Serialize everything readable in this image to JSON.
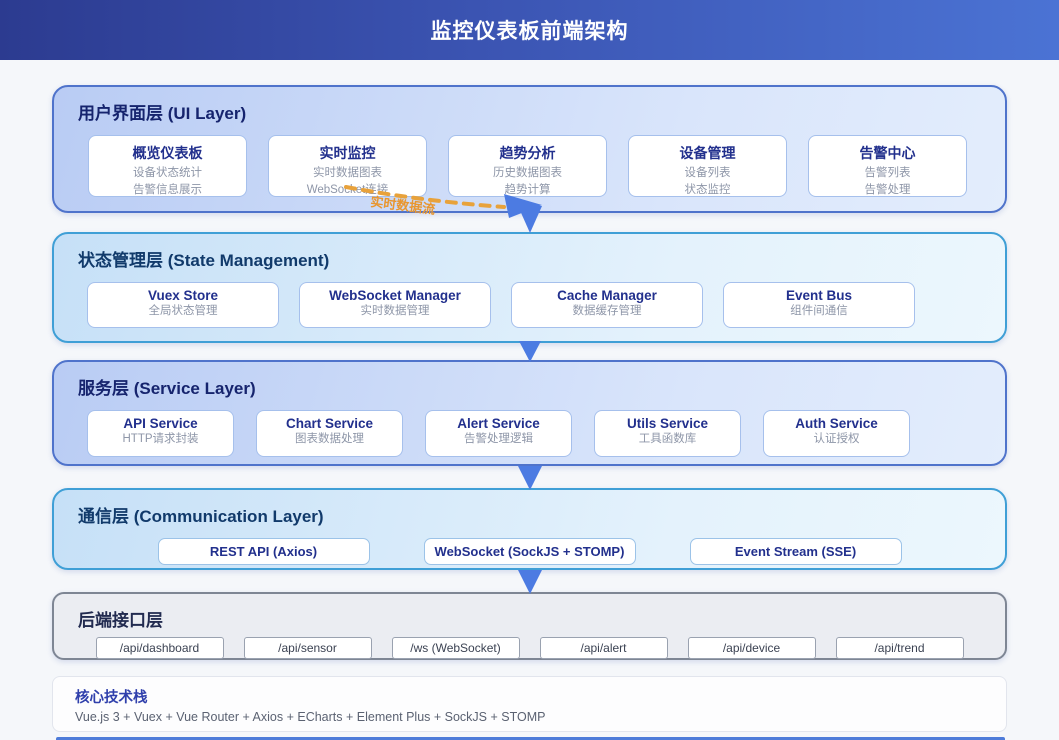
{
  "header": {
    "title": "监控仪表板前端架构"
  },
  "flow": {
    "label": "实时数据流"
  },
  "colors": {
    "arrow": "#4c7be2",
    "flow_line": "#e8a23b",
    "flow_label": "#e8962f"
  },
  "layers": [
    {
      "slug": "ui",
      "title": "用户界面层 (UI Layer)",
      "variant": "blue",
      "cards": [
        {
          "title": "概览仪表板",
          "lines": [
            "设备状态统计",
            "告警信息展示"
          ]
        },
        {
          "title": "实时监控",
          "lines": [
            "实时数据图表",
            "WebSocket连接"
          ]
        },
        {
          "title": "趋势分析",
          "lines": [
            "历史数据图表",
            "趋势计算"
          ]
        },
        {
          "title": "设备管理",
          "lines": [
            "设备列表",
            "状态监控"
          ]
        },
        {
          "title": "告警中心",
          "lines": [
            "告警列表",
            "告警处理"
          ]
        }
      ]
    },
    {
      "slug": "state-management",
      "title": "状态管理层 (State Management)",
      "variant": "cyan",
      "cards": [
        {
          "title": "Vuex Store",
          "lines": [
            "全局状态管理"
          ]
        },
        {
          "title": "WebSocket Manager",
          "lines": [
            "实时数据管理"
          ]
        },
        {
          "title": "Cache Manager",
          "lines": [
            "数据缓存管理"
          ]
        },
        {
          "title": "Event Bus",
          "lines": [
            "组件间通信"
          ]
        }
      ]
    },
    {
      "slug": "service",
      "title": "服务层 (Service Layer)",
      "variant": "blue",
      "cards": [
        {
          "title": "API Service",
          "lines": [
            "HTTP请求封装"
          ]
        },
        {
          "title": "Chart Service",
          "lines": [
            "图表数据处理"
          ]
        },
        {
          "title": "Alert Service",
          "lines": [
            "告警处理逻辑"
          ]
        },
        {
          "title": "Utils Service",
          "lines": [
            "工具函数库"
          ]
        },
        {
          "title": "Auth Service",
          "lines": [
            "认证授权"
          ]
        }
      ]
    },
    {
      "slug": "communication",
      "title": "通信层 (Communication Layer)",
      "variant": "cyan",
      "cards": [
        {
          "title": "REST API (Axios)",
          "lines": []
        },
        {
          "title": "WebSocket (SockJS + STOMP)",
          "lines": []
        },
        {
          "title": "Event Stream (SSE)",
          "lines": []
        }
      ]
    },
    {
      "slug": "backend-api",
      "title": "后端接口层",
      "variant": "gray",
      "cards": [
        {
          "title": "/api/dashboard",
          "lines": []
        },
        {
          "title": "/api/sensor",
          "lines": []
        },
        {
          "title": "/ws (WebSocket)",
          "lines": []
        },
        {
          "title": "/api/alert",
          "lines": []
        },
        {
          "title": "/api/device",
          "lines": []
        },
        {
          "title": "/api/trend",
          "lines": []
        }
      ]
    }
  ],
  "tech": {
    "title": "核心技术栈",
    "stack": "Vue.js 3 + Vuex + Vue Router + Axios + ECharts + Element Plus + SockJS + STOMP"
  }
}
